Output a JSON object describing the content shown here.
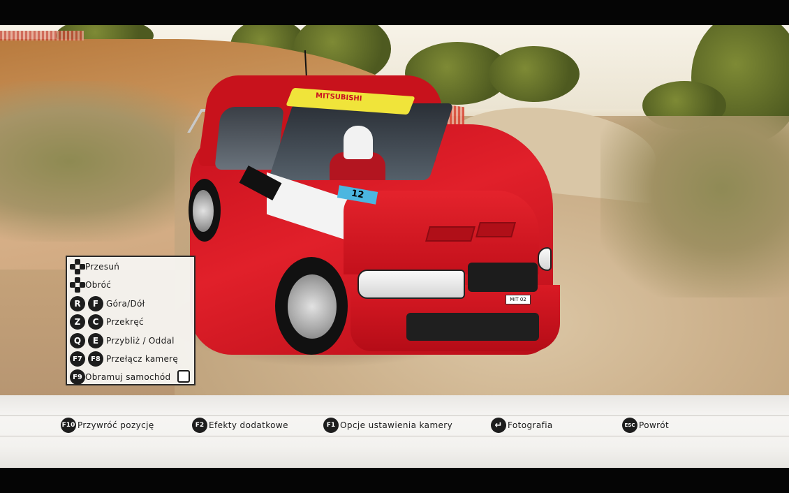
{
  "controls": [
    {
      "icon": "dpad-move-icon",
      "keys": [],
      "label": "Przesuń"
    },
    {
      "icon": "dpad-rotate-icon",
      "keys": [],
      "label": "Obróć"
    },
    {
      "keys": [
        "R",
        "F"
      ],
      "label": "Góra/Dół"
    },
    {
      "keys": [
        "Z",
        "C"
      ],
      "label": "Przekręć"
    },
    {
      "keys": [
        "Q",
        "E"
      ],
      "label": "Przybliż / Oddal"
    },
    {
      "keys": [
        "F7",
        "F8"
      ],
      "label": "Przełącz kamerę"
    },
    {
      "keys": [
        "F9"
      ],
      "label": "Obramuj samochód",
      "checkbox": false
    }
  ],
  "bottom_bar": [
    {
      "key": "F10",
      "label": "Przywróć pozycję"
    },
    {
      "key": "F2",
      "label": "Efekty dodatkowe"
    },
    {
      "key": "F1",
      "label": "Opcje ustawienia kamery"
    },
    {
      "key": "↵",
      "label": "Fotografia"
    },
    {
      "key": "ESC",
      "label": "Powrót"
    }
  ],
  "car": {
    "number": "12",
    "sunstrip": "MITSUBISHI",
    "plate": "MIT 02"
  },
  "colors": {
    "car_red": "#d8141f",
    "panel_bg": "#f6f4f1",
    "key_bg": "#1d1d1d"
  }
}
